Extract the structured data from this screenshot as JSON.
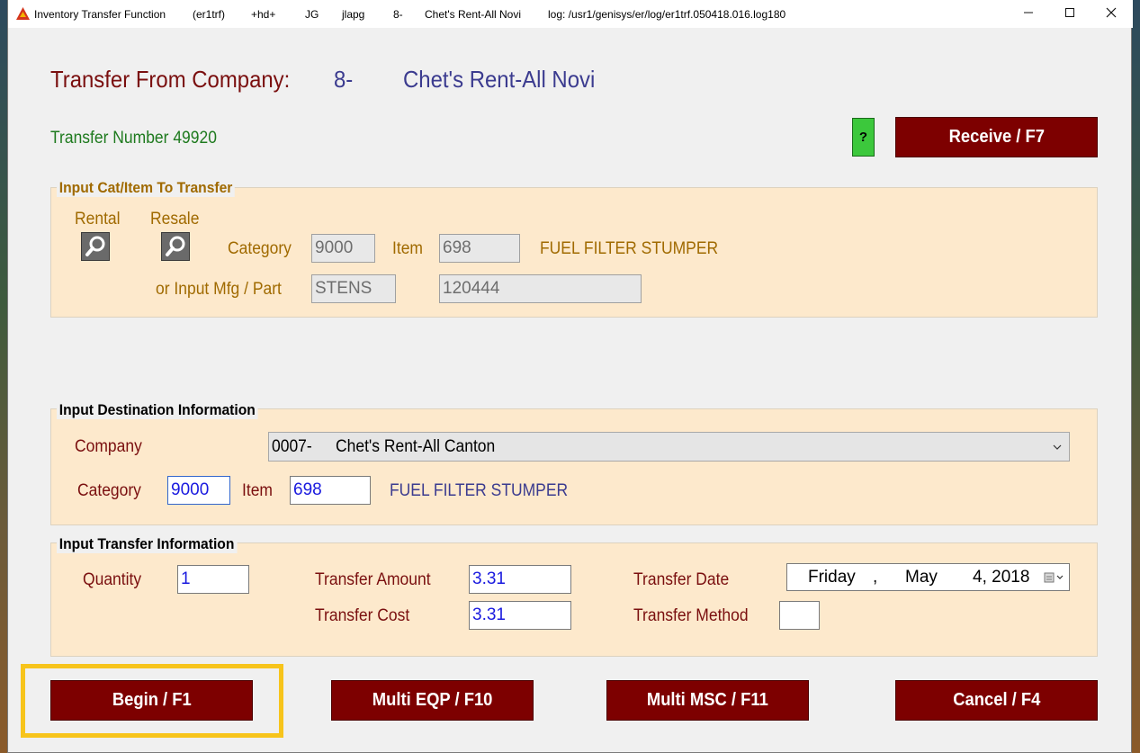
{
  "titlebar": {
    "app_name": "Inventory Transfer Function",
    "program": "(er1trf)",
    "hd": "+hd+",
    "user": "JG",
    "host": "jlapg",
    "company_no": "8-",
    "company_name": "Chet's Rent-All Novi",
    "log": "log: /usr1/genisys/er/log/er1trf.050418.016.log180"
  },
  "header": {
    "transfer_from_label": "Transfer From Company:",
    "company_no": "8-",
    "company_name": "Chet's Rent-All Novi",
    "transfer_number": "Transfer Number 49920",
    "help_label": "?",
    "receive_label": "Receive / F7"
  },
  "cat_item_group": {
    "title": "Input Cat/Item To Transfer",
    "rental_label": "Rental",
    "resale_label": "Resale",
    "category_label": "Category",
    "category_value": "9000",
    "item_label": "Item",
    "item_value": "698",
    "description": "FUEL FILTER STUMPER",
    "mfg_part_label": "or Input Mfg / Part",
    "mfg_value": "STENS",
    "part_value": "120444"
  },
  "destination_group": {
    "title": "Input Destination Information",
    "company_label": "Company",
    "company_no": "0007-",
    "company_name": "Chet's Rent-All Canton",
    "category_label": "Category",
    "category_value": "9000",
    "item_label": "Item",
    "item_value": "698",
    "description": "FUEL FILTER STUMPER"
  },
  "transfer_group": {
    "title": "Input Transfer Information",
    "quantity_label": "Quantity",
    "quantity_value": "1",
    "amount_label": "Transfer Amount",
    "amount_value": "3.31",
    "cost_label": "Transfer Cost",
    "cost_value": "3.31",
    "date_label": "Transfer Date",
    "date_weekday": "Friday",
    "date_sep": ",",
    "date_month": "May",
    "date_day_year": "4, 2018",
    "method_label": "Transfer Method",
    "method_value": ""
  },
  "buttons": {
    "begin": "Begin / F1",
    "multi_eqp": "Multi EQP / F10",
    "multi_msc": "Multi MSC / F11",
    "cancel": "Cancel / F4"
  },
  "colors": {
    "accent_maroon": "#7d0000",
    "group_bg": "#fde9cc",
    "highlight": "#f7c41b",
    "help_green": "#3cc83c"
  }
}
